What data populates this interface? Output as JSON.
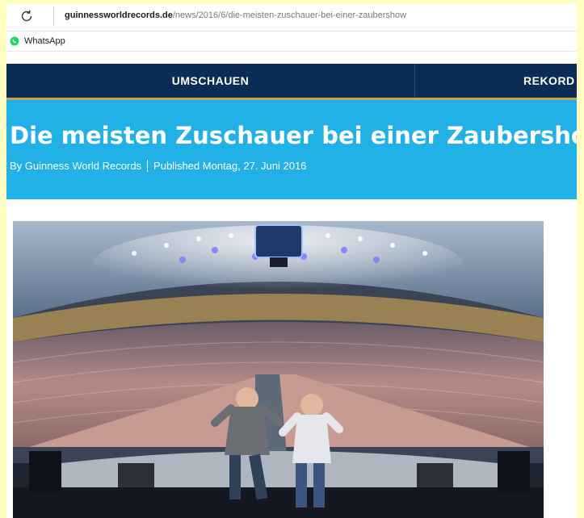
{
  "browser": {
    "url_host": "guinnessworldrecords.de",
    "url_path": "/news/2016/6/die-meisten-zuschauer-bei-einer-zaubershow",
    "reload_icon": "reload-icon"
  },
  "bookmarks": [
    {
      "label": "WhatsApp",
      "icon": "whatsapp-icon",
      "color": "#25d366"
    }
  ],
  "nav": {
    "items": [
      "UMSCHAUEN",
      "REKORD"
    ]
  },
  "article": {
    "title": "Die meisten Zuschauer bei einer Zaubershow",
    "author": "By Guinness World Records",
    "published": "Published Montag, 27. Juni 2016"
  },
  "colors": {
    "nav_bg": "#0b2d55",
    "hero_bg": "#22b1e6",
    "gold_rule": "#c7a445",
    "page_outer": "#ffffc4"
  }
}
